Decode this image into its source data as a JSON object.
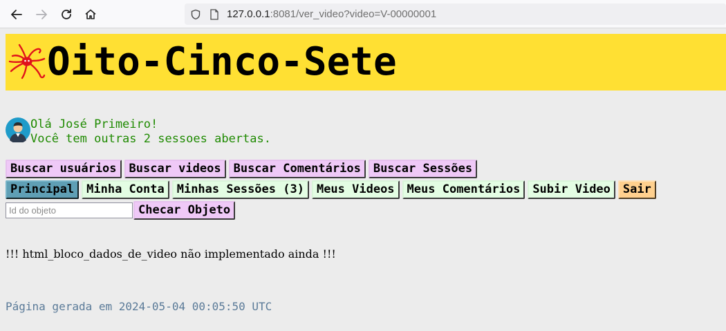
{
  "browser": {
    "url_host": "127.0.0.1",
    "url_rest": ":8081/ver_video?video=V-00000001"
  },
  "site": {
    "title": "Oito-Cinco-Sete"
  },
  "user": {
    "greeting_line1": "Olá José Primeiro!",
    "greeting_line2": "Você tem outras 2 sessoes abertas."
  },
  "search_buttons": [
    {
      "label": "Buscar usuários"
    },
    {
      "label": "Buscar videos"
    },
    {
      "label": "Buscar Comentários"
    },
    {
      "label": "Buscar Sessões"
    }
  ],
  "menu_buttons": [
    {
      "label": "Principal"
    },
    {
      "label": "Minha Conta"
    },
    {
      "label": "Minhas Sessões (3)"
    },
    {
      "label": "Meus Videos"
    },
    {
      "label": "Meus Comentários"
    },
    {
      "label": "Subir Video"
    },
    {
      "label": "Sair"
    }
  ],
  "object_check": {
    "placeholder": "Id do objeto",
    "button_label": "Checar Objeto"
  },
  "message": "!!! html_bloco_dados_de_video não implementado ainda !!!",
  "footer": {
    "generated_at": "Página gerada em 2024-05-04 00:05:50 UTC"
  },
  "colors": {
    "banner": "#ffe033",
    "greeting": "#1e8a00",
    "violet_button": "#efc9f7",
    "mint_button": "#e3fde3",
    "active_button": "#5f9fb5",
    "exit_button": "#ffd08e",
    "footer_text": "#5a7a98"
  }
}
